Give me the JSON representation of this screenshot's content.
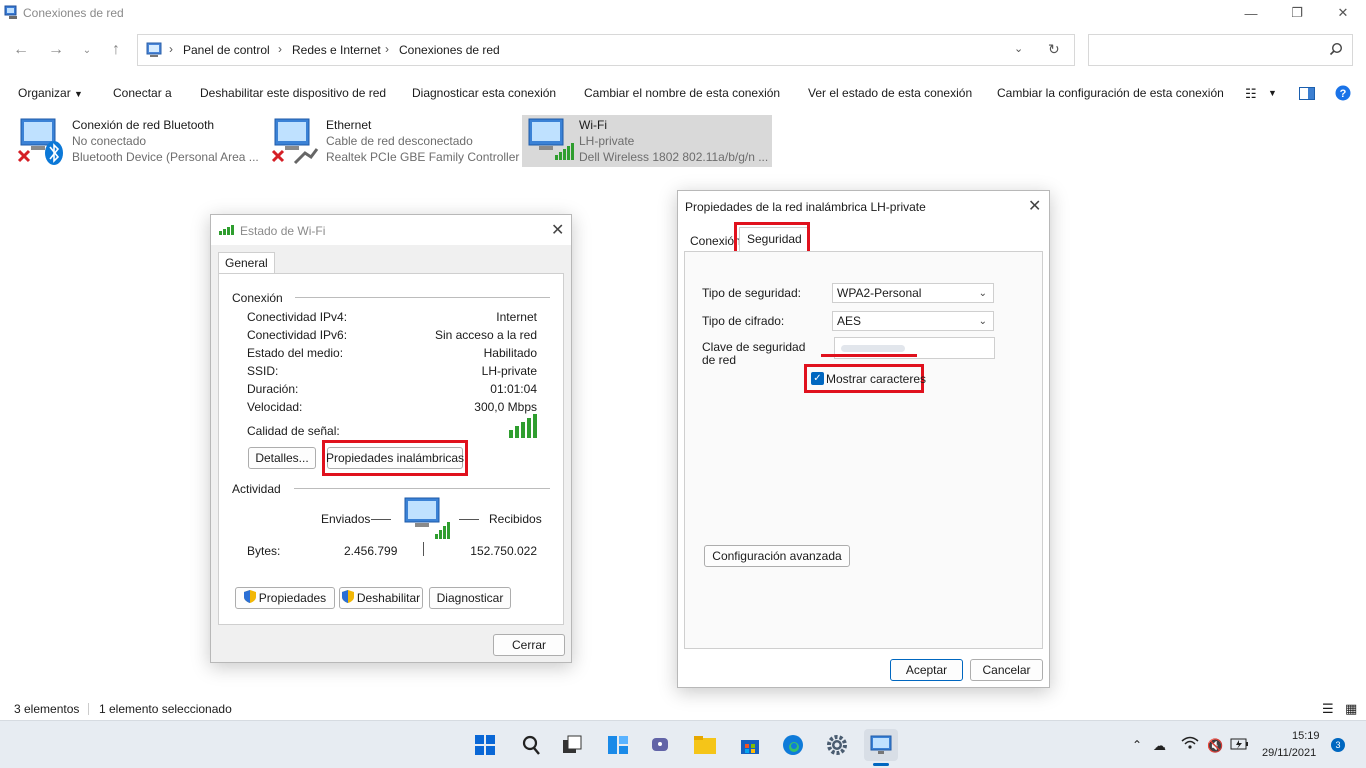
{
  "window": {
    "title": "Conexiones de red"
  },
  "address": {
    "crumbs": [
      "Panel de control",
      "Redes e Internet",
      "Conexiones de red"
    ]
  },
  "commands": {
    "organize": "Organizar",
    "connect": "Conectar a",
    "disable": "Deshabilitar este dispositivo de red",
    "diagnose": "Diagnosticar esta conexión",
    "rename": "Cambiar el nombre de esta conexión",
    "status": "Ver el estado de esta conexión",
    "config": "Cambiar la configuración de esta conexión"
  },
  "connections": [
    {
      "name": "Conexión de red Bluetooth",
      "status": "No conectado",
      "device": "Bluetooth Device (Personal Area ..."
    },
    {
      "name": "Ethernet",
      "status": "Cable de red desconectado",
      "device": "Realtek PCIe GBE Family Controller"
    },
    {
      "name": "Wi-Fi",
      "status": "LH-private",
      "device": "Dell Wireless 1802 802.11a/b/g/n ..."
    }
  ],
  "wifi_status": {
    "title": "Estado de Wi-Fi",
    "tab": "General",
    "section_connection": "Conexión",
    "rows": [
      {
        "label": "Conectividad IPv4:",
        "value": "Internet"
      },
      {
        "label": "Conectividad IPv6:",
        "value": "Sin acceso a la red"
      },
      {
        "label": "Estado del medio:",
        "value": "Habilitado"
      },
      {
        "label": "SSID:",
        "value": "LH-private"
      },
      {
        "label": "Duración:",
        "value": "01:01:04"
      },
      {
        "label": "Velocidad:",
        "value": "300,0 Mbps"
      }
    ],
    "signal_label": "Calidad de señal:",
    "details_btn": "Detalles...",
    "wireless_props_btn": "Propiedades inalámbricas",
    "section_activity": "Actividad",
    "sent_label": "Enviados",
    "received_label": "Recibidos",
    "bytes_label": "Bytes:",
    "bytes_sent": "2.456.799",
    "bytes_received": "152.750.022",
    "props_btn": "Propiedades",
    "disable_btn": "Deshabilitar",
    "diagnose_btn": "Diagnosticar",
    "close_btn": "Cerrar"
  },
  "wireless_props": {
    "title": "Propiedades de la red inalámbrica LH-private",
    "tab_connection": "Conexión",
    "tab_security": "Seguridad",
    "security_type_label": "Tipo de seguridad:",
    "security_type_value": "WPA2-Personal",
    "encryption_label": "Tipo de cifrado:",
    "encryption_value": "AES",
    "key_label": "Clave de seguridad de red",
    "show_chars_label": "Mostrar caracteres",
    "show_chars_checked": true,
    "advanced_btn": "Configuración avanzada",
    "accept_btn": "Aceptar",
    "cancel_btn": "Cancelar"
  },
  "statusbar": {
    "count": "3 elementos",
    "selected": "1 elemento seleccionado"
  },
  "taskbar": {
    "time": "15:19",
    "date": "29/11/2021",
    "notifications": "3"
  },
  "colors": {
    "highlight_red": "#e0111d",
    "accent_blue": "#0067c0"
  }
}
